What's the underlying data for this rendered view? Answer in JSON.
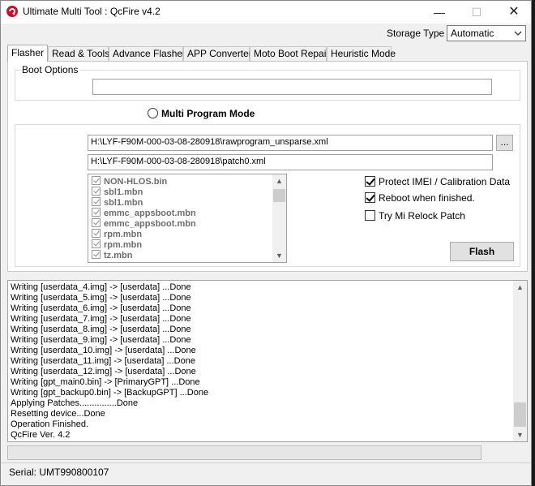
{
  "window": {
    "title": "Ultimate Multi Tool : QcFire v4.2",
    "brand_color": "#c8102e"
  },
  "storage": {
    "label": "Storage Type",
    "selected": "Automatic"
  },
  "tabs": [
    {
      "label": "Flasher",
      "active": true
    },
    {
      "label": "Read & Tools",
      "active": false
    },
    {
      "label": "Advance Flasher",
      "active": false
    },
    {
      "label": "APP Converter",
      "active": false
    },
    {
      "label": "Moto Boot Repair",
      "active": false
    },
    {
      "label": "Heuristic Mode",
      "active": false
    }
  ],
  "flasher": {
    "boot_options_label": "Boot Options",
    "boot_options_value": "",
    "multi_program_label": "Multi Program Mode",
    "rawprogram_path": "H:\\LYF-F90M-000-03-08-280918\\rawprogram_unsparse.xml",
    "patch_path": "H:\\LYF-F90M-000-03-08-280918\\patch0.xml",
    "browse_label": "...",
    "files": [
      {
        "name": "NON-HLOS.bin",
        "checked": true
      },
      {
        "name": "sbl1.mbn",
        "checked": true
      },
      {
        "name": "sbl1.mbn",
        "checked": true
      },
      {
        "name": "emmc_appsboot.mbn",
        "checked": true
      },
      {
        "name": "emmc_appsboot.mbn",
        "checked": true
      },
      {
        "name": "rpm.mbn",
        "checked": true
      },
      {
        "name": "rpm.mbn",
        "checked": true
      },
      {
        "name": "tz.mbn",
        "checked": true
      }
    ],
    "options": [
      {
        "label": "Protect IMEI / Calibration Data",
        "checked": true
      },
      {
        "label": "Reboot when finished.",
        "checked": true
      },
      {
        "label": "Try Mi Relock Patch",
        "checked": false
      }
    ],
    "flash_label": "Flash"
  },
  "log": [
    "Writing [userdata_4.img] -> [userdata] ...Done",
    "Writing [userdata_5.img] -> [userdata] ...Done",
    "Writing [userdata_6.img] -> [userdata] ...Done",
    "Writing [userdata_7.img] -> [userdata] ...Done",
    "Writing [userdata_8.img] -> [userdata] ...Done",
    "Writing [userdata_9.img] -> [userdata] ...Done",
    "Writing [userdata_10.img] -> [userdata] ...Done",
    "Writing [userdata_11.img] -> [userdata] ...Done",
    "Writing [userdata_12.img] -> [userdata] ...Done",
    "Writing [gpt_main0.bin] -> [PrimaryGPT] ...Done",
    "Writing [gpt_backup0.bin] -> [BackupGPT] ...Done",
    "Applying Patches...............Done",
    "Resetting device...Done",
    "Operation Finished.",
    "QcFire Ver. 4.2"
  ],
  "progress": {
    "fraction": 0.0
  },
  "status": {
    "serial": "Serial: UMT990800107"
  }
}
